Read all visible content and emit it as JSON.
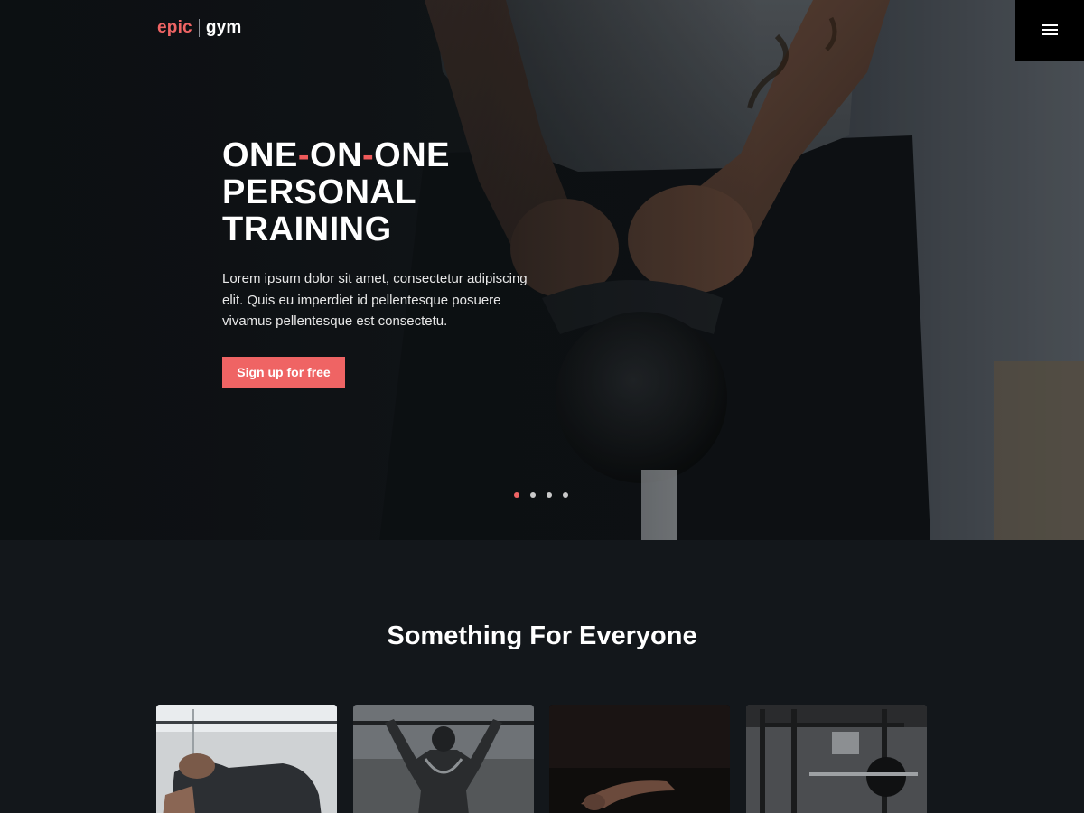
{
  "brand": {
    "part1": "epic",
    "part2": "gym"
  },
  "hero": {
    "title_segments": [
      "ONE",
      "-",
      "ON",
      "-",
      "ONE"
    ],
    "title_line2": "PERSONAL",
    "title_line3": "TRAINING",
    "description": "Lorem ipsum dolor sit amet, consectetur adipiscing elit. Quis eu imperdiet id pellentesque posuere vivamus pellentesque est consectetu.",
    "cta_label": "Sign up for free",
    "slider": {
      "count": 4,
      "active_index": 0
    }
  },
  "section": {
    "title": "Something For Everyone"
  },
  "cards": [
    {
      "image": "woman-training-photo"
    },
    {
      "image": "man-pullup-photo"
    },
    {
      "image": "dark-stretch-photo"
    },
    {
      "image": "gym-equipment-photo"
    }
  ],
  "colors": {
    "accent": "#ef6464",
    "background": "#13171b",
    "menu_bg": "#000000"
  },
  "icons": {
    "menu": "hamburger-menu-icon"
  }
}
